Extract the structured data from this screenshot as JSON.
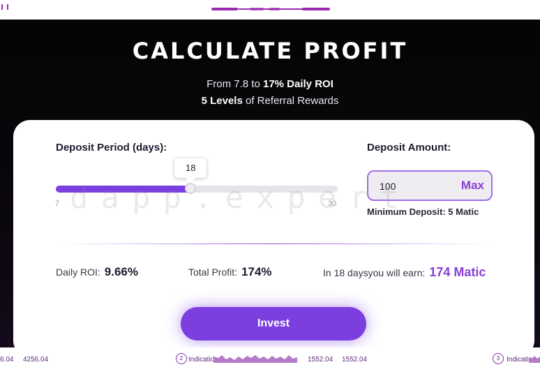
{
  "hero": {
    "title": "CALCULATE PROFIT",
    "line1_prefix": "From 7.8 to ",
    "line1_bold": "17% Daily ROI",
    "line2_bold": "5 Levels",
    "line2_suffix": " of Referral Rewards"
  },
  "calculator": {
    "period_label": "Deposit Period (days):",
    "period_value": "18",
    "period_min": "7",
    "period_max": "30",
    "amount_label": "Deposit Amount:",
    "amount_value": "100",
    "max_label": "Max",
    "min_deposit": "Minimum Deposit: 5 Matic",
    "daily_roi_label": "Daily ROI:",
    "daily_roi_value": "9.66%",
    "total_profit_label": "Total Profit:",
    "total_profit_value": "174%",
    "earn_label": "In 18 daysyou will earn:",
    "earn_value": "174 Matic",
    "invest_label": "Invest"
  },
  "watermark": "dapp.expert",
  "ticker": {
    "v1": "6.04",
    "v2": "4256.04",
    "badge1": "2",
    "ind1": "Indication",
    "v3": "1552.04",
    "v4": "1552.04",
    "badge2": "3",
    "ind2": "Indication"
  },
  "colors": {
    "accent": "#7b3fe0",
    "accent_text": "#8a3fd8",
    "hero_bg": "#050505"
  }
}
